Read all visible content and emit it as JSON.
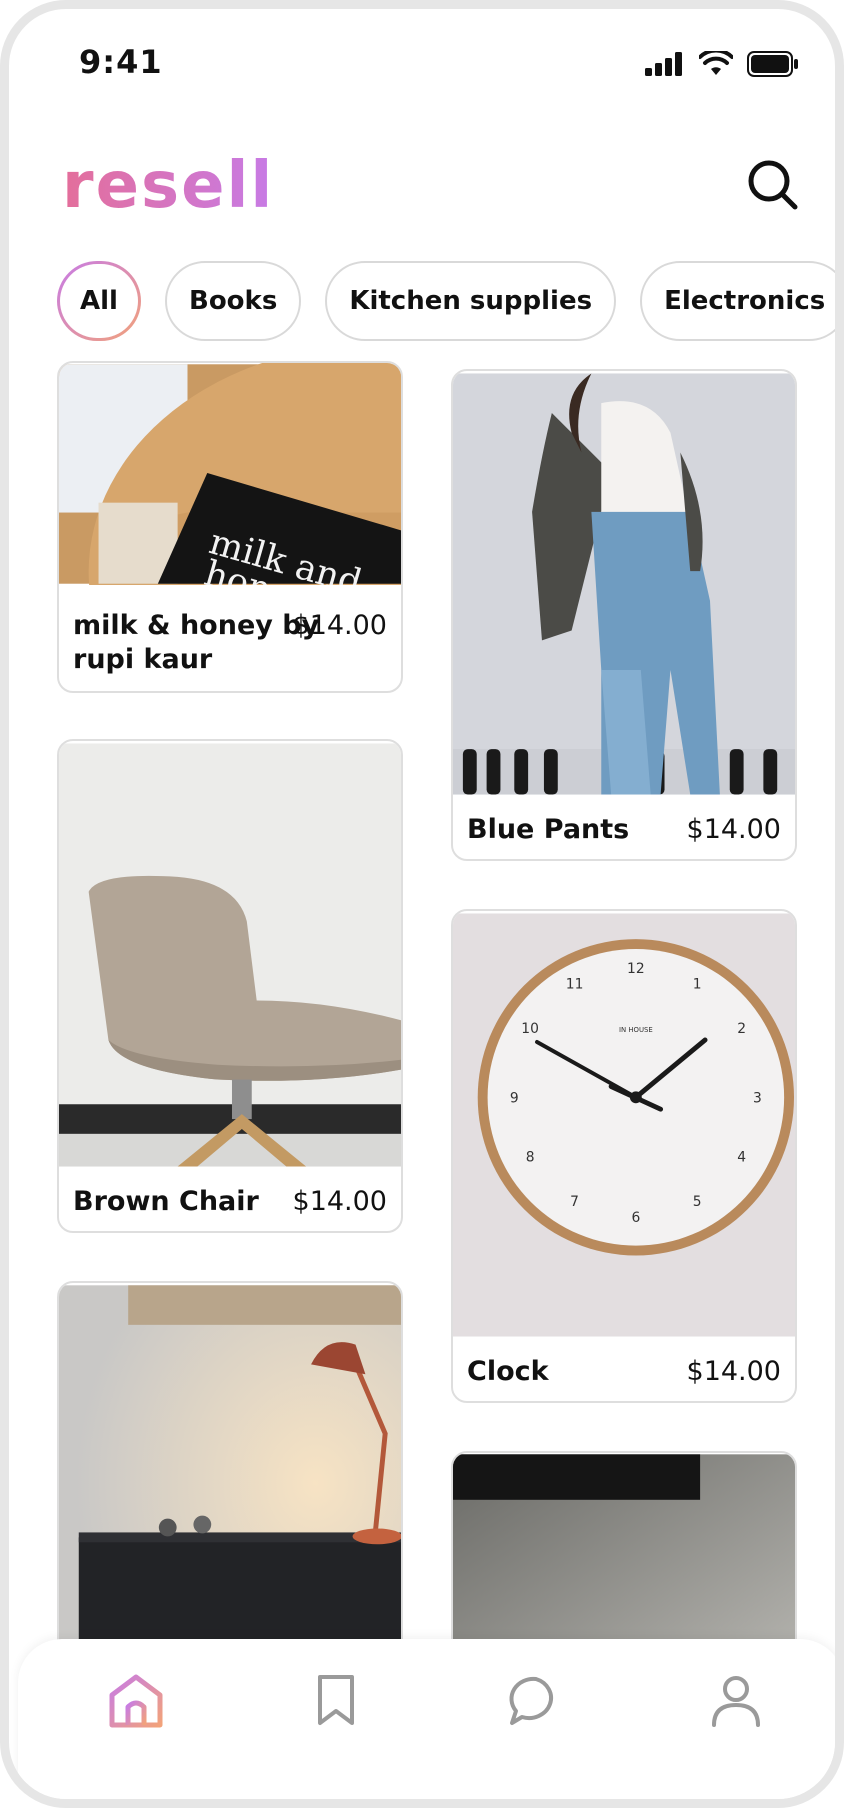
{
  "status_bar": {
    "time": "9:41"
  },
  "header": {
    "logo_text": "resell",
    "search_icon": "search-icon"
  },
  "categories": [
    {
      "label": "All",
      "active": true
    },
    {
      "label": "Books",
      "active": false
    },
    {
      "label": "Kitchen supplies",
      "active": false
    },
    {
      "label": "Electronics",
      "active": false
    }
  ],
  "listings": [
    {
      "title": "milk & honey by rupi kaur",
      "title_line1": "milk & honey by",
      "title_line2": "rupi kaur",
      "price": "$14.00"
    },
    {
      "title": "Blue Pants",
      "price": "$14.00"
    },
    {
      "title": "Brown Chair",
      "price": "$14.00"
    },
    {
      "title": "Clock",
      "price": "$14.00"
    },
    {
      "title": "",
      "price": ""
    },
    {
      "title": "",
      "price": ""
    }
  ],
  "book_cover_text": [
    "milk and",
    "hon"
  ],
  "clock_face": {
    "brand": "IN HOUSE",
    "numerals": [
      "12",
      "1",
      "2",
      "3",
      "4",
      "5",
      "6",
      "7",
      "8",
      "9",
      "10",
      "11"
    ]
  },
  "bottom_nav": [
    {
      "icon": "home-icon",
      "active": true
    },
    {
      "icon": "bookmark-icon",
      "active": false
    },
    {
      "icon": "chat-icon",
      "active": false
    },
    {
      "icon": "profile-icon",
      "active": false
    }
  ],
  "colors": {
    "accent_start": "#c77be6",
    "accent_end": "#f2a27a",
    "logo_pink": "#e46e9a"
  }
}
